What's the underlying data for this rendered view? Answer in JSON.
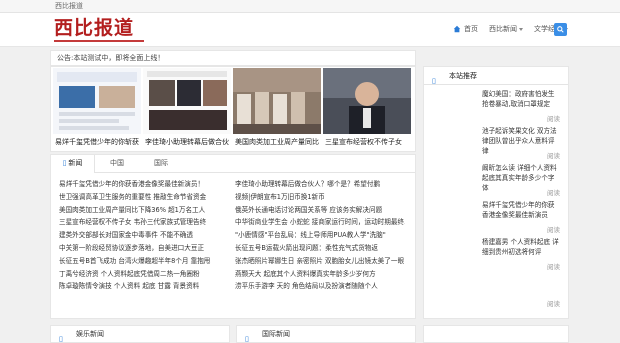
{
  "topbar": {
    "text": "西比报道"
  },
  "header": {
    "logo": "西比报道",
    "nav": [
      {
        "label": "首页",
        "icon": "home-icon",
        "dropdown": false
      },
      {
        "label": "西比新闻",
        "dropdown": true
      },
      {
        "label": "文学经典",
        "dropdown": true
      }
    ]
  },
  "notice": {
    "text": "公告:本站测试中，即将全面上线！"
  },
  "gallery": [
    {
      "caption": "易烊千玺凭借少年的你斩获"
    },
    {
      "caption": "李佳琦小助理转幕后做合伙"
    },
    {
      "caption": "美国肉类加工业周产量同比"
    },
    {
      "caption": "三星宣布经营权不传子女"
    }
  ],
  "tabs": [
    {
      "label": "新闻",
      "active": true
    },
    {
      "label": "中国",
      "active": false
    },
    {
      "label": "国际",
      "active": false
    }
  ],
  "news_left": [
    "易烊千玺凭借少年的你获香港金像奖最佳新演员！",
    "世卫强调高革卫生服务的重要性 推敲生命节省资金",
    "美国肉类加工业周产量同比下降36% 超1万名工人",
    "三星宣布经营权不传子女 韦孙三代家族式管理告终",
    "建类外交部部长对国家金中毒事件 不能不确透",
    "中关第一阶段经贸协议逐步落地，自美进口大豆正",
    "长征五号B首飞成功 台湾火爆趣超半年8个月 靠抱甩",
    "丁禹兮经济资 个人资料起底凭借周二热一角圈粉",
    "陈卓璇陈情令演技 个人资料 起底 甘露 背景资料"
  ],
  "news_right": [
    "李佳琦小助理转幕后做合伙人？哪个是？希望付鹏",
    "视频|伊朗宣布1万旧币换1新币",
    "俄英外长通电话讨论两国关系等 应该务实解决问题",
    "中华街商业学生会 小蛇蛇 接商家运行时间，运动时期最终以新闻能",
    "\"小鹿情感\"平台乱局：线上导师用PUA教人学\"洗脑\"",
    "长征五号B运载火箭出现问题：柔性充气式货物返",
    "张杰晒照片幂娜生日 亲密照片 双胞胎女儿出镜太美了一眼",
    "燕颢天大 起底其个人资料爆真实年龄多少岁何方",
    "涝平乐手游李 天的 角色结局以及扮演者随随个人"
  ],
  "sidebar": {
    "title": "本站推荐",
    "items": [
      {
        "title": "魔幻美国：政府害怕发生 抢卷暴动,取消口罩规定",
        "read": "阅读"
      },
      {
        "title": "池子起诉笑果文化 双方法 律团队曾出乎众人意料评律",
        "read": "阅读"
      },
      {
        "title": "阚昕怎么读 详细个人资料 起底其真实年龄多少个字 体",
        "read": "阅读"
      },
      {
        "title": "易烊千玺凭借少年的你获 香港金像奖最佳新演员",
        "read": "阅读"
      },
      {
        "title": "杨建嘉男 个人资料起底 详细到贵州初选将何评",
        "read": "阅读"
      },
      {
        "title": "",
        "read": "阅读"
      }
    ]
  },
  "bottom": [
    {
      "label": "娱乐新闻"
    },
    {
      "label": "国际新闻"
    }
  ]
}
